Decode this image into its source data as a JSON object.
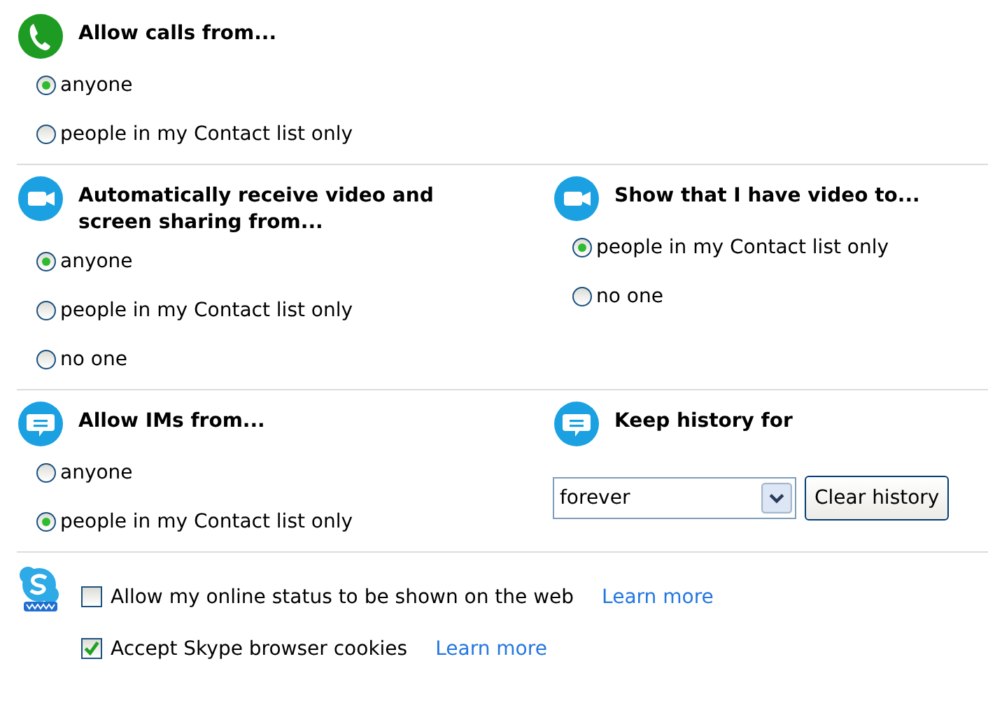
{
  "rows": [
    [
      {
        "kind": "phone",
        "title": "Allow calls from...",
        "options": [
          {
            "label": "anyone",
            "selected": true
          },
          {
            "label": "people in my Contact list only",
            "selected": false
          }
        ]
      }
    ],
    [
      {
        "kind": "video",
        "title": "Automatically receive video and screen sharing from...",
        "options": [
          {
            "label": "anyone",
            "selected": true
          },
          {
            "label": "people in my Contact list only",
            "selected": false
          },
          {
            "label": "no one",
            "selected": false
          }
        ]
      },
      {
        "kind": "video",
        "title": "Show that I have video to...",
        "options": [
          {
            "label": "people in my Contact list only",
            "selected": true
          },
          {
            "label": "no one",
            "selected": false
          }
        ]
      }
    ],
    [
      {
        "kind": "chat",
        "title": "Allow IMs from...",
        "options": [
          {
            "label": "anyone",
            "selected": false
          },
          {
            "label": "people in my Contact list only",
            "selected": true
          }
        ]
      },
      {
        "kind": "chat",
        "title": "Keep history for",
        "value": "forever",
        "button": "Clear history"
      }
    ]
  ],
  "web": {
    "checkboxes": [
      {
        "label": "Allow my online status to be shown on the web",
        "checked": false,
        "link": "Learn more"
      },
      {
        "label": "Accept Skype browser cookies",
        "checked": true,
        "link": "Learn more"
      }
    ]
  }
}
